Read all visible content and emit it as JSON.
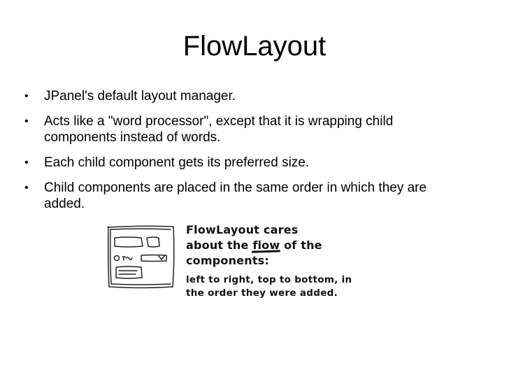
{
  "slide": {
    "title": "FlowLayout",
    "bullets": [
      "JPanel's default layout manager.",
      "Acts like a \"word processor\", except that it is wrapping child components instead of words.",
      "Each child component gets its preferred size.",
      "Child components are placed in the same order in which they are added."
    ],
    "bullet_marker": "•"
  },
  "figure": {
    "sketch_icon": "window-sketch-icon",
    "heading_line1": "FlowLayout cares",
    "heading_line2_before": "about the ",
    "heading_line2_emphasis": "flow",
    "heading_line2_after": " of the",
    "heading_line3": "components:",
    "detail_line1": "left to right, top to bottom, in",
    "detail_line2": "the order they were added."
  }
}
